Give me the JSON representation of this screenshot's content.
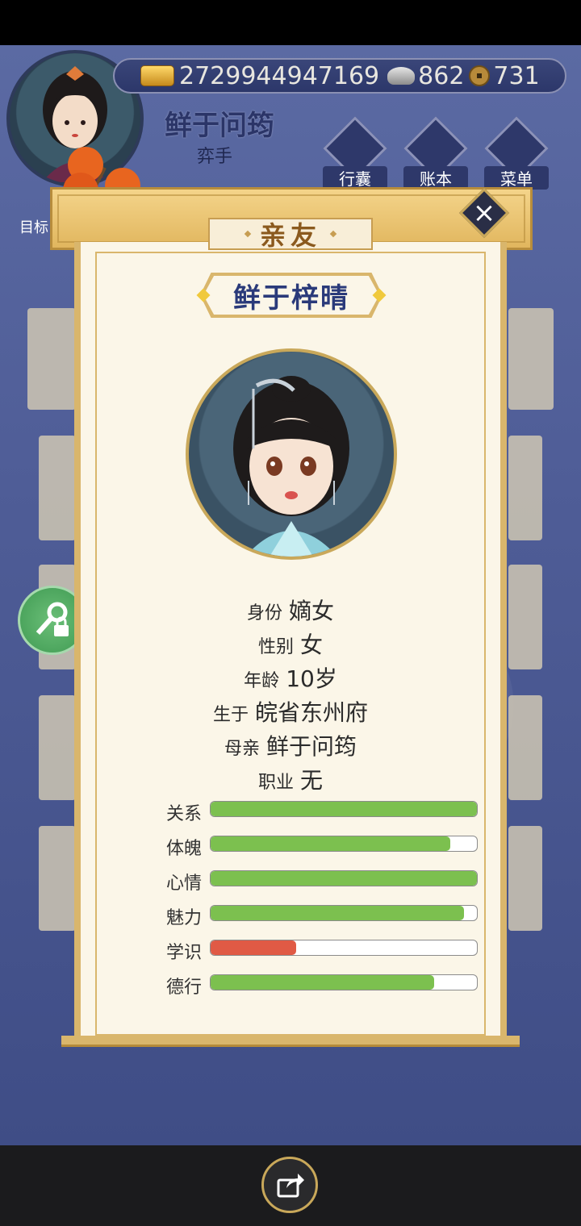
{
  "currency": {
    "gold": "2729944947169",
    "silver": "862",
    "coins": "731"
  },
  "player": {
    "name": "鲜于问筠",
    "title": "弈手"
  },
  "hud": {
    "bag": "行囊",
    "ledger": "账本",
    "menu": "菜单",
    "target": "目标"
  },
  "dialog": {
    "title": "亲友",
    "character_name": "鲜于梓晴",
    "info": [
      {
        "label": "身份",
        "value": "嫡女"
      },
      {
        "label": "性别",
        "value": "女"
      },
      {
        "label": "年龄",
        "value": "10岁"
      },
      {
        "label": "生于",
        "value": "皖省东州府"
      },
      {
        "label": "母亲",
        "value": "鲜于问筠"
      },
      {
        "label": "职业",
        "value": "无"
      }
    ],
    "stats": [
      {
        "label": "关系",
        "fraction": 1.0,
        "color": "#7cc04f"
      },
      {
        "label": "体魄",
        "fraction": 0.9,
        "color": "#7cc04f"
      },
      {
        "label": "心情",
        "fraction": 1.0,
        "color": "#7cc04f"
      },
      {
        "label": "魅力",
        "fraction": 0.95,
        "color": "#7cc04f"
      },
      {
        "label": "学识",
        "fraction": 0.32,
        "color": "#e05a45"
      },
      {
        "label": "德行",
        "fraction": 0.84,
        "color": "#7cc04f"
      }
    ]
  },
  "icons": {
    "close": "close-icon",
    "share": "share-icon",
    "key": "key-lock-icon"
  }
}
